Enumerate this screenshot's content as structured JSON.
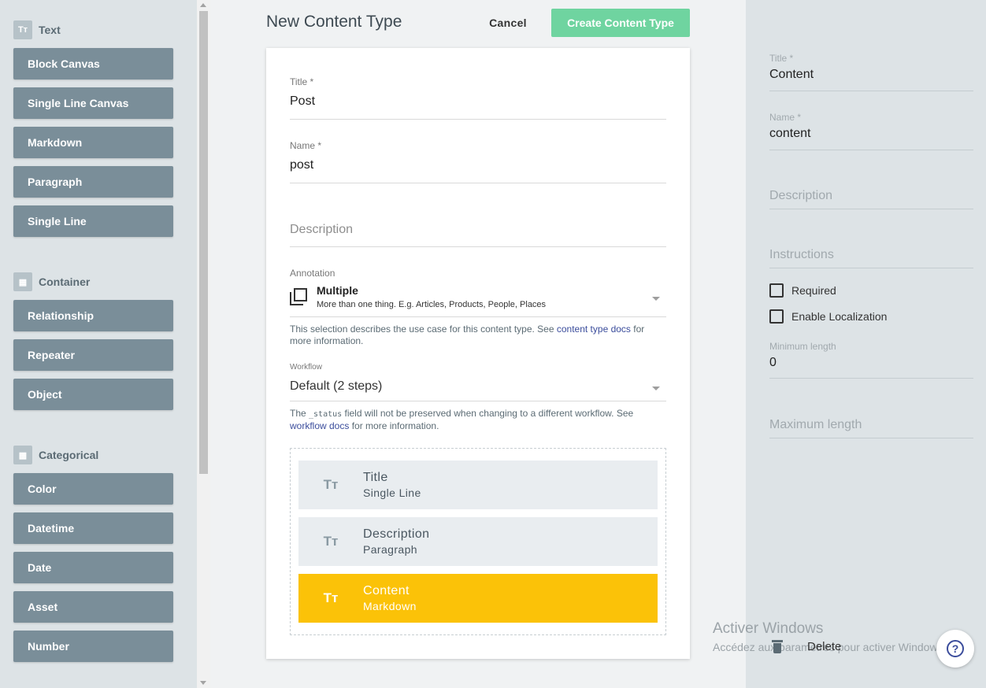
{
  "palette": {
    "groups": [
      {
        "label": "Text",
        "icon": "Tт",
        "items": [
          "Block Canvas",
          "Single Line Canvas",
          "Markdown",
          "Paragraph",
          "Single Line"
        ]
      },
      {
        "label": "Container",
        "icon": "▦",
        "items": [
          "Relationship",
          "Repeater",
          "Object"
        ]
      },
      {
        "label": "Categorical",
        "icon": "▩",
        "items": [
          "Color",
          "Datetime",
          "Date",
          "Asset",
          "Number"
        ]
      }
    ]
  },
  "header": {
    "title": "New Content Type",
    "cancel_label": "Cancel",
    "create_label": "Create Content Type"
  },
  "form": {
    "title_label": "Title *",
    "title_value": "Post",
    "name_label": "Name *",
    "name_value": "post",
    "description_placeholder": "Description",
    "annotation_label": "Annotation",
    "annotation_title": "Multiple",
    "annotation_desc": "More than one thing. E.g. Articles, Products, People, Places",
    "annotation_help_pre": "This selection describes the use case for this content type. See ",
    "annotation_help_link": "content type docs",
    "annotation_help_post": " for more information.",
    "workflow_label": "Workflow",
    "workflow_value": "Default (2 steps)",
    "workflow_help_pre": "The ",
    "workflow_help_code": "_status",
    "workflow_help_mid": " field will not be preserved when changing to a different workflow. See ",
    "workflow_help_link": "workflow docs",
    "workflow_help_post": " for more information."
  },
  "fields": [
    {
      "icon": "Tт",
      "title": "Title",
      "type": "Single Line"
    },
    {
      "icon": "Tт",
      "title": "Description",
      "type": "Paragraph"
    },
    {
      "icon": "Tт",
      "title": "Content",
      "type": "Markdown"
    }
  ],
  "right_panel": {
    "title_label": "Title *",
    "title_value": "Content",
    "name_label": "Name *",
    "name_value": "content",
    "description_placeholder": "Description",
    "instructions_placeholder": "Instructions",
    "required_label": "Required",
    "localization_label": "Enable Localization",
    "min_label": "Minimum length",
    "min_value": "0",
    "max_placeholder": "Maximum length",
    "delete_label": "Delete",
    "help_glyph": "?"
  },
  "watermark": {
    "line1": "Activer Windows",
    "line2": "Accédez aux paramètres pour activer Windows."
  },
  "colors": {
    "palette_button": "#7a8e99",
    "create_button": "#6fd4a0",
    "active_field": "#fbc208",
    "link": "#3b4d9c"
  }
}
